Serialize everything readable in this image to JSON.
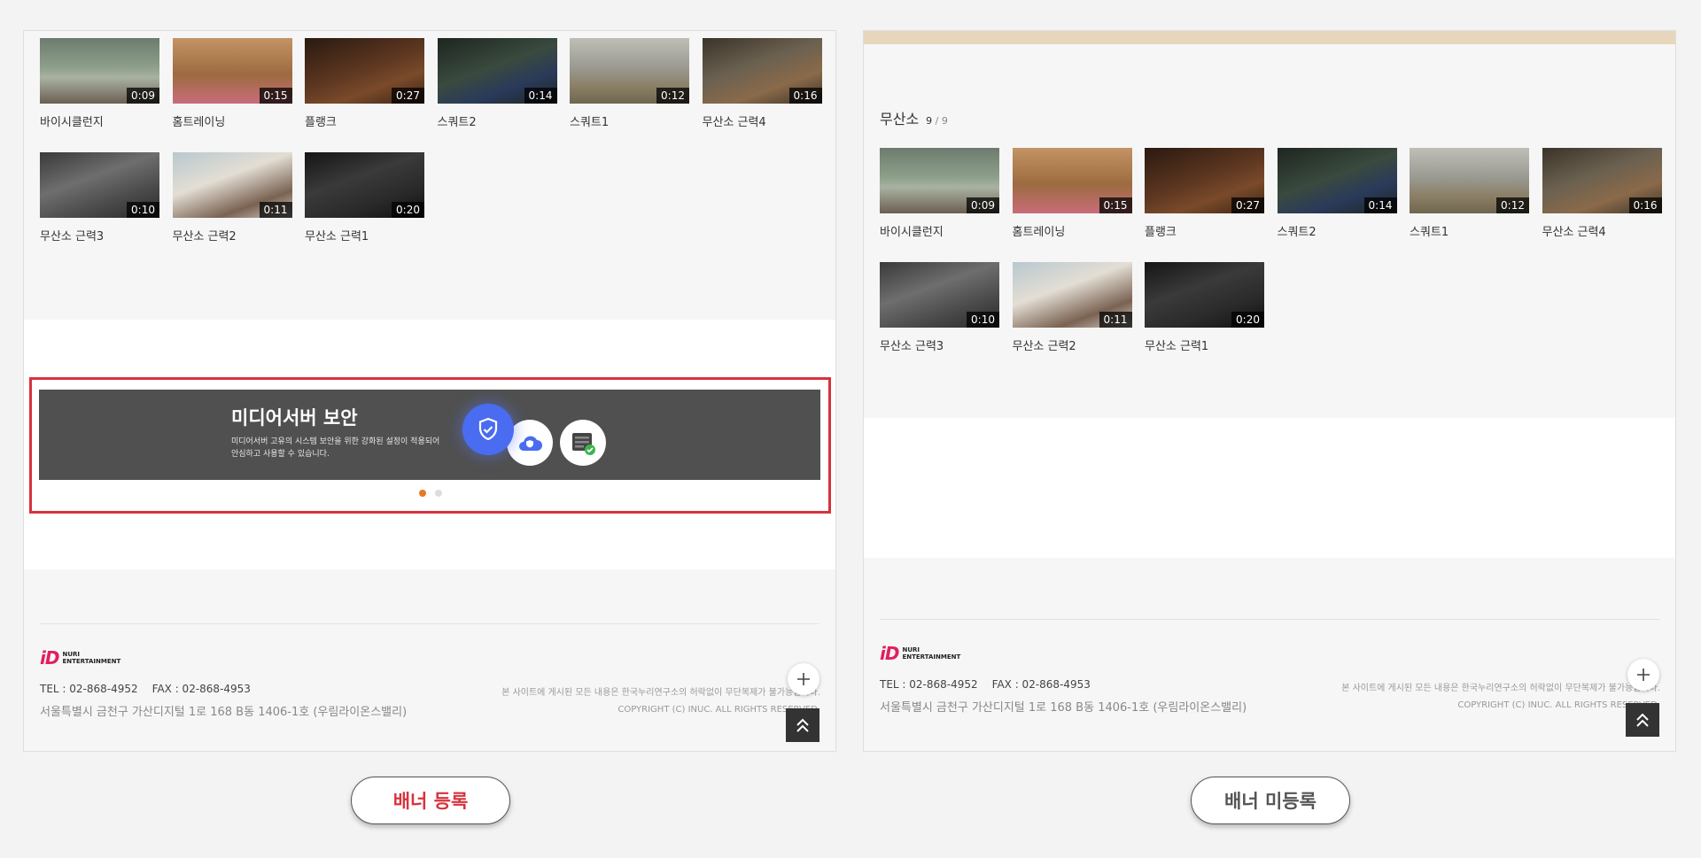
{
  "videos": [
    {
      "title": "바이시클런지",
      "duration": "0:09"
    },
    {
      "title": "홈트레이닝",
      "duration": "0:15"
    },
    {
      "title": "플랭크",
      "duration": "0:27"
    },
    {
      "title": "스쿼트2",
      "duration": "0:14"
    },
    {
      "title": "스쿼트1",
      "duration": "0:12"
    },
    {
      "title": "무산소 근력4",
      "duration": "0:16"
    },
    {
      "title": "무산소 근력3",
      "duration": "0:10"
    },
    {
      "title": "무산소 근력2",
      "duration": "0:11"
    },
    {
      "title": "무산소 근력1",
      "duration": "0:20"
    }
  ],
  "section": {
    "title": "무산소",
    "count": "9",
    "total": "/ 9"
  },
  "banner": {
    "title": "미디어서버 보안",
    "desc": "미디어서버 고유의 시스템 보안을 위한 강화된 설정이 적용되어 안심하고 사용할 수 있습니다.",
    "icons": [
      "shield-icon",
      "cloud-shield-icon",
      "server-check-icon"
    ],
    "slides": 2,
    "active_slide": 1
  },
  "footer": {
    "logo_text_1": "NURI",
    "logo_text_2": "ENTERTAINMENT",
    "tel": "TEL : 02-868-4952",
    "fax": "FAX : 02-868-4953",
    "address": "서울특별시 금천구 가산디지털 1로 168 B동 1406-1호 (우림라이온스밸리)",
    "notice": "본 사이트에 게시된 모든 내용은 한국누리연구소의 허락없이 무단복제가 불가능합니다.",
    "copyright": "COPYRIGHT (C) INUC. ALL RIGHTS RESERVED."
  },
  "labels": {
    "banner_registered": "배너 등록",
    "banner_unregistered": "배너 미등록"
  },
  "colors": {
    "accent_red": "#d8323c",
    "active_dot": "#e47a25",
    "shield_blue": "#4a6cf0",
    "top_bar": "#e8d6bc"
  }
}
